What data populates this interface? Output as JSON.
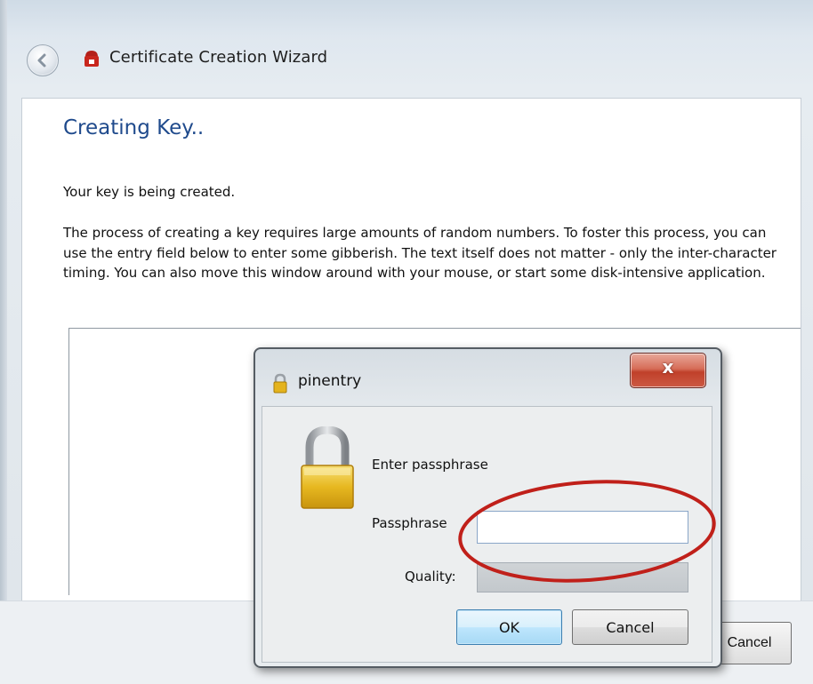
{
  "wizard": {
    "title": "Certificate Creation Wizard",
    "heading": "Creating Key..",
    "status": "Your key is being created.",
    "description": "The process of creating a key requires large amounts of random numbers. To foster this process, you can use the entry field below to enter some gibberish. The text itself does not matter - only the inter-character timing. You can also move this window around with your mouse, or start some disk-intensive application.",
    "cancel_label": "Cancel"
  },
  "pinentry": {
    "title": "pinentry",
    "close_label": "x",
    "prompt": "Enter passphrase",
    "passphrase_label": "Passphrase",
    "passphrase_value": "",
    "quality_label": "Quality:",
    "quality_value": 0,
    "ok_label": "OK",
    "cancel_label": "Cancel"
  },
  "colors": {
    "heading": "#1f4a8c",
    "highlight_ellipse": "#c0201a",
    "close_button": "#c0402a",
    "lock": "#e7b820"
  },
  "icons": {
    "back": "back-arrow-icon",
    "app": "certificate-app-icon",
    "pinentry_title": "padlock-icon",
    "lock": "large-padlock-icon"
  }
}
